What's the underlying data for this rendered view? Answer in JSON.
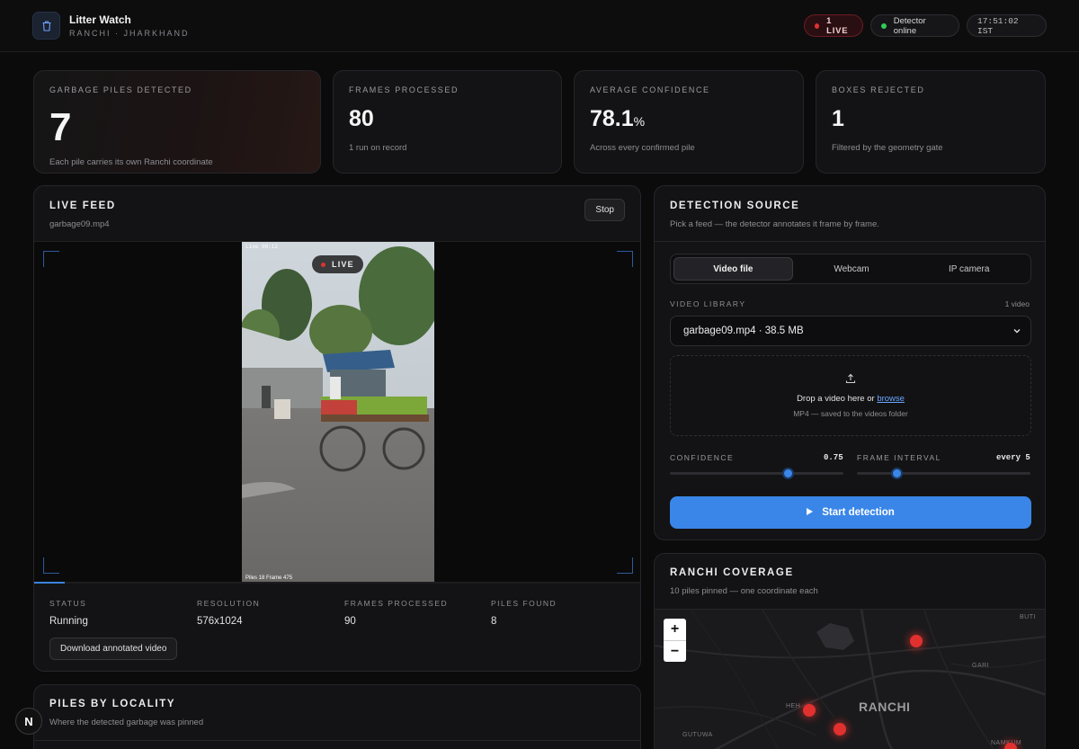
{
  "header": {
    "title": "Litter Watch",
    "subtitle": "RANCHI · JHARKHAND",
    "live_label": "1 LIVE",
    "detector_label": "Detector online",
    "clock": "17:51:02 IST"
  },
  "stats": [
    {
      "label": "GARBAGE PILES DETECTED",
      "value": "7",
      "unit": "",
      "note": "Each pile carries its own Ranchi coordinate"
    },
    {
      "label": "FRAMES PROCESSED",
      "value": "80",
      "unit": "",
      "note": "1 run on record"
    },
    {
      "label": "AVERAGE CONFIDENCE",
      "value": "78.1",
      "unit": "%",
      "note": "Across every confirmed pile"
    },
    {
      "label": "BOXES REJECTED",
      "value": "1",
      "unit": "",
      "note": "Filtered by the geometry gate"
    }
  ],
  "live_feed": {
    "title": "LIVE FEED",
    "file": "garbage09.mp4",
    "stop_label": "Stop",
    "badge": "LIVE",
    "overlay_top": "Live 00:12",
    "overlay_bottom": "Piles 18   Frame 475",
    "progress": 0.05,
    "meta": [
      {
        "label": "STATUS",
        "value": "Running"
      },
      {
        "label": "RESOLUTION",
        "value": "576x1024"
      },
      {
        "label": "FRAMES PROCESSED",
        "value": "90"
      },
      {
        "label": "PILES FOUND",
        "value": "8"
      }
    ],
    "download_label": "Download annotated video"
  },
  "piles": {
    "title": "PILES BY LOCALITY",
    "subtitle": "Where the detected garbage was pinned"
  },
  "detection": {
    "title": "DETECTION SOURCE",
    "subtitle": "Pick a feed — the detector annotates it frame by frame.",
    "tabs": [
      "Video file",
      "Webcam",
      "IP camera"
    ],
    "active_tab": 0,
    "library_label": "VIDEO LIBRARY",
    "library_count": "1 video",
    "selected_video": "garbage09.mp4 · 38.5 MB",
    "drop_text": "Drop a video here or ",
    "drop_link": "browse",
    "drop_sub": "MP4 — saved to the videos folder",
    "confidence_label": "CONFIDENCE",
    "confidence_value": "0.75",
    "confidence_level": 0.68,
    "interval_label": "FRAME INTERVAL",
    "interval_value": "every 5",
    "interval_level": 0.23,
    "start_label": "Start detection"
  },
  "coverage": {
    "title": "RANCHI COVERAGE",
    "subtitle": "10 piles pinned — one coordinate each",
    "zoom_in": "+",
    "zoom_out": "−",
    "labels": {
      "buti": "BUTI",
      "gari": "GARI",
      "heh": "HEH",
      "ranchi": "RANCHI",
      "gutuwa": "GUTUWA",
      "namkum": "NAMKUM"
    }
  },
  "colors": {
    "accent": "#3a86e8",
    "live": "#e0312f",
    "online": "#2ecc55",
    "pin": "#e0312f"
  },
  "n_badge": "N"
}
